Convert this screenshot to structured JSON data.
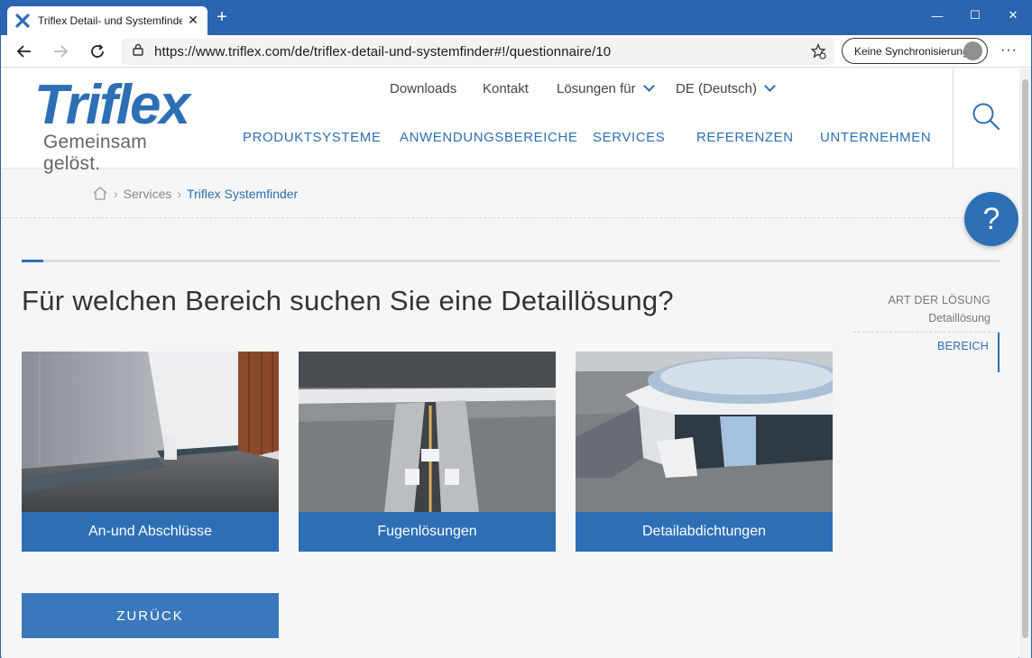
{
  "browser": {
    "tab_title": "Triflex Detail- und Systemfinder |",
    "url": "https://www.triflex.com/de/triflex-detail-und-systemfinder#!/questionnaire/10",
    "sync_label": "Keine Synchronisierung",
    "new_tab": "+",
    "tab_close": "✕",
    "more": "···",
    "window_controls": [
      "—",
      "☐",
      "✕"
    ]
  },
  "header": {
    "logo_text": "Triflex",
    "slogan": "Gemeinsam gelöst.",
    "top_nav": [
      {
        "label": "Downloads",
        "dropdown": false
      },
      {
        "label": "Kontakt",
        "dropdown": false
      },
      {
        "label": "Lösungen für",
        "dropdown": true
      },
      {
        "label": "DE (Deutsch)",
        "dropdown": true
      }
    ],
    "main_nav": [
      "PRODUKTSYSTEME",
      "ANWENDUNGSBEREICHE",
      "SERVICES",
      "REFERENZEN",
      "UNTERNEHMEN"
    ]
  },
  "breadcrumb": {
    "items": [
      "Services",
      "Triflex Systemfinder"
    ],
    "separator": "›"
  },
  "help_label": "?",
  "progress": {
    "fraction": 0.022
  },
  "question": "Für welchen Bereich suchen Sie eine Detaillösung?",
  "steps": {
    "label": "ART DER LÖSUNG",
    "value": "Detaillösung",
    "active": "BEREICH"
  },
  "cards": [
    {
      "label": "An-und Abschlüsse"
    },
    {
      "label": "Fugenlösungen"
    },
    {
      "label": "Detailabdichtungen"
    }
  ],
  "back_label": "ZURÜCK",
  "colors": {
    "brand": "#2d6fb5",
    "browser_chrome": "#2b64b0"
  }
}
